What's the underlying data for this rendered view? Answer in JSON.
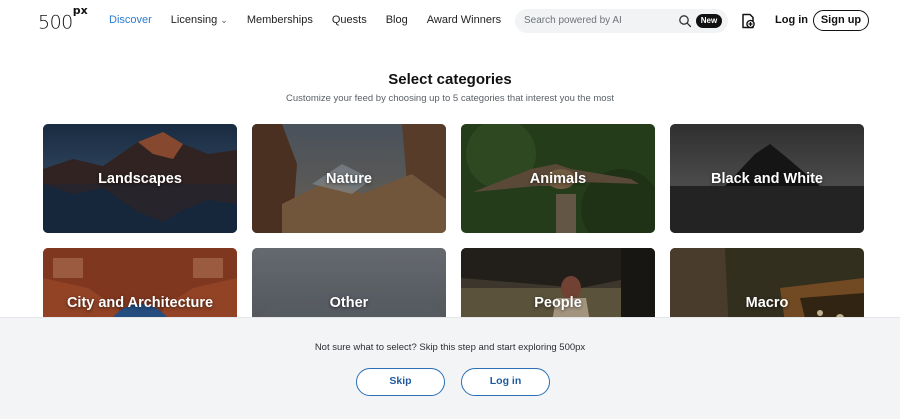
{
  "header": {
    "logo_text": "500",
    "logo_sup": "px",
    "nav": [
      {
        "label": "Discover",
        "active": true
      },
      {
        "label": "Licensing",
        "has_dropdown": true
      },
      {
        "label": "Memberships"
      },
      {
        "label": "Quests"
      },
      {
        "label": "Blog"
      },
      {
        "label": "Award Winners"
      }
    ],
    "search_placeholder": "Search powered by AI",
    "new_badge": "New",
    "login": "Log in",
    "signup": "Sign up",
    "dropdown_icon": "chevron-down-icon",
    "upload_icon": "upload-icon",
    "search_icon": "search-icon"
  },
  "main": {
    "title": "Select categories",
    "subtitle": "Customize your feed by choosing up to 5 categories that interest you the most",
    "categories": [
      {
        "label": "Landscapes"
      },
      {
        "label": "Nature"
      },
      {
        "label": "Animals"
      },
      {
        "label": "Black and White"
      },
      {
        "label": "City and Architecture"
      },
      {
        "label": "Other"
      },
      {
        "label": "People"
      },
      {
        "label": "Macro"
      }
    ]
  },
  "footer": {
    "text": "Not sure what to select? Skip this step and start exploring 500px",
    "skip": "Skip",
    "login": "Log in"
  },
  "colors": {
    "accent": "#2b7bd1",
    "button_border": "#2b6fb6",
    "footer_bg": "#f3f4f6"
  }
}
